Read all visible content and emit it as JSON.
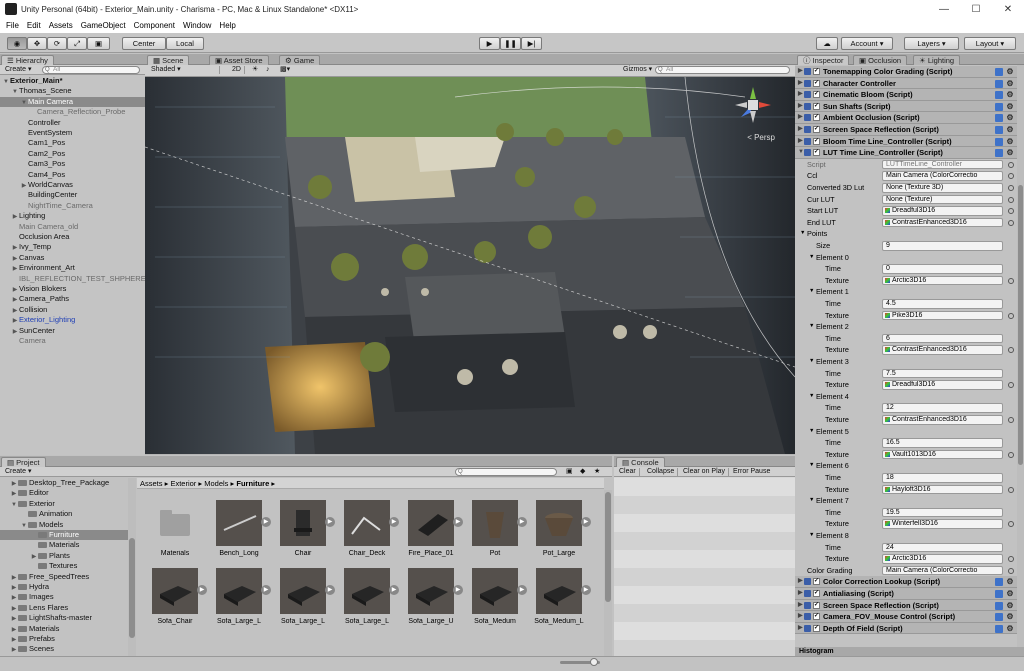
{
  "window": {
    "title": "Unity Personal (64bit) - Exterior_Main.unity - Charisma - PC, Mac & Linux Standalone* <DX11>"
  },
  "menu": [
    "File",
    "Edit",
    "Assets",
    "GameObject",
    "Component",
    "Window",
    "Help"
  ],
  "toolbar": {
    "pivot_label": "Center",
    "space_label": "Local",
    "account_label": "Account",
    "layers_label": "Layers",
    "layout_label": "Layout"
  },
  "hierarchy": {
    "tab": "Hierarchy",
    "create_label": "Create",
    "search_placeholder": "All",
    "items": [
      {
        "label": "Exterior_Main*",
        "bold": true,
        "depth": 0,
        "arrow": "open"
      },
      {
        "label": "Thomas_Scene",
        "depth": 1,
        "arrow": "open"
      },
      {
        "label": "Main Camera",
        "depth": 2,
        "arrow": "open",
        "selected": true
      },
      {
        "label": "Camera_Reflection_Probe",
        "depth": 3,
        "dim": true
      },
      {
        "label": "Controller",
        "depth": 2
      },
      {
        "label": "EventSystem",
        "depth": 2
      },
      {
        "label": "Cam1_Pos",
        "depth": 2
      },
      {
        "label": "Cam2_Pos",
        "depth": 2
      },
      {
        "label": "Cam3_Pos",
        "depth": 2
      },
      {
        "label": "Cam4_Pos",
        "depth": 2
      },
      {
        "label": "WorldCanvas",
        "depth": 2,
        "arrow": "closed"
      },
      {
        "label": "BuildingCenter",
        "depth": 2
      },
      {
        "label": "NightTime_Camera",
        "depth": 2,
        "dim": true
      },
      {
        "label": "Lighting",
        "depth": 1,
        "arrow": "closed"
      },
      {
        "label": "Main Camera_old",
        "depth": 1,
        "dim": true
      },
      {
        "label": "Occlusion Area",
        "depth": 1
      },
      {
        "label": "Ivy_Temp",
        "depth": 1,
        "arrow": "closed"
      },
      {
        "label": "Canvas",
        "depth": 1,
        "arrow": "closed"
      },
      {
        "label": "Environment_Art",
        "depth": 1,
        "arrow": "closed"
      },
      {
        "label": "IBL_REFLECTION_TEST_SHPHERE",
        "depth": 1,
        "dim": true
      },
      {
        "label": "Vision Blokers",
        "depth": 1,
        "arrow": "closed"
      },
      {
        "label": "Camera_Paths",
        "depth": 1,
        "arrow": "closed"
      },
      {
        "label": "Collision",
        "depth": 1,
        "arrow": "closed"
      },
      {
        "label": "Exterior_Lighting",
        "depth": 1,
        "arrow": "closed",
        "blue": true
      },
      {
        "label": "SunCenter",
        "depth": 1,
        "arrow": "closed"
      },
      {
        "label": "Camera",
        "depth": 1,
        "dim": true
      }
    ]
  },
  "scene": {
    "tabs": [
      "Scene",
      "Asset Store",
      "Game"
    ],
    "shading": "Shaded",
    "mode_2d": "2D",
    "gizmos": "Gizmos",
    "search_placeholder": "All",
    "persp_label": "< Persp"
  },
  "inspector": {
    "tabs": [
      "Inspector",
      "Occlusion",
      "Lighting"
    ],
    "components_top": [
      "Tonemapping Color Grading (Script)",
      "Character Controller",
      "Cinematic Bloom (Script)",
      "Sun Shafts (Script)",
      "Ambient Occlusion (Script)",
      "Screen Space Reflection (Script)",
      "Bloom Time Line_Controller (Script)",
      "LUT Time Line_Controller (Script)"
    ],
    "props": [
      {
        "label": "Script",
        "value": "LUTTimeLine_Controller",
        "indent": 0,
        "dim": true
      },
      {
        "label": "Ccl",
        "value": "Main Camera (ColorCorrectio",
        "indent": 0
      },
      {
        "label": "Converted 3D Lut",
        "value": "None (Texture 3D)",
        "indent": 0
      },
      {
        "label": "Cur LUT",
        "value": "None (Texture)",
        "indent": 0
      },
      {
        "label": "Start LUT",
        "value": "Dreadful3D16",
        "indent": 0,
        "lut": true
      },
      {
        "label": "End LUT",
        "value": "ContrastEnhanced3D16",
        "indent": 0,
        "lut": true
      },
      {
        "label": "Points",
        "value": null,
        "indent": 0,
        "arrow": true
      },
      {
        "label": "Size",
        "value": "9",
        "indent": 1
      },
      {
        "label": "Element 0",
        "value": null,
        "indent": 1,
        "arrow": true
      },
      {
        "label": "Time",
        "value": "0",
        "indent": 2
      },
      {
        "label": "Texture",
        "value": "Arctic3D16",
        "indent": 2,
        "lut": true
      },
      {
        "label": "Element 1",
        "value": null,
        "indent": 1,
        "arrow": true
      },
      {
        "label": "Time",
        "value": "4.5",
        "indent": 2
      },
      {
        "label": "Texture",
        "value": "Pike3D16",
        "indent": 2,
        "lut": true
      },
      {
        "label": "Element 2",
        "value": null,
        "indent": 1,
        "arrow": true
      },
      {
        "label": "Time",
        "value": "6",
        "indent": 2
      },
      {
        "label": "Texture",
        "value": "ContrastEnhanced3D16",
        "indent": 2,
        "lut": true
      },
      {
        "label": "Element 3",
        "value": null,
        "indent": 1,
        "arrow": true
      },
      {
        "label": "Time",
        "value": "7.5",
        "indent": 2
      },
      {
        "label": "Texture",
        "value": "Dreadful3D16",
        "indent": 2,
        "lut": true
      },
      {
        "label": "Element 4",
        "value": null,
        "indent": 1,
        "arrow": true
      },
      {
        "label": "Time",
        "value": "12",
        "indent": 2
      },
      {
        "label": "Texture",
        "value": "ContrastEnhanced3D16",
        "indent": 2,
        "lut": true
      },
      {
        "label": "Element 5",
        "value": null,
        "indent": 1,
        "arrow": true
      },
      {
        "label": "Time",
        "value": "16.5",
        "indent": 2
      },
      {
        "label": "Texture",
        "value": "Vault1013D16",
        "indent": 2,
        "lut": true
      },
      {
        "label": "Element 6",
        "value": null,
        "indent": 1,
        "arrow": true
      },
      {
        "label": "Time",
        "value": "18",
        "indent": 2
      },
      {
        "label": "Texture",
        "value": "Hayloft3D16",
        "indent": 2,
        "lut": true
      },
      {
        "label": "Element 7",
        "value": null,
        "indent": 1,
        "arrow": true
      },
      {
        "label": "Time",
        "value": "19.5",
        "indent": 2
      },
      {
        "label": "Texture",
        "value": "Winterfell3D16",
        "indent": 2,
        "lut": true
      },
      {
        "label": "Element 8",
        "value": null,
        "indent": 1,
        "arrow": true
      },
      {
        "label": "Time",
        "value": "24",
        "indent": 2
      },
      {
        "label": "Texture",
        "value": "Arctic3D16",
        "indent": 2,
        "lut": true
      },
      {
        "label": "Color Grading",
        "value": "Main Camera (ColorCorrectio",
        "indent": 0
      }
    ],
    "components_bottom": [
      "Color Correction Lookup (Script)",
      "Antialiasing (Script)",
      "Screen Space Reflection (Script)",
      "Camera_FOV_Mouse Control (Script)",
      "Depth Of Field (Script)"
    ],
    "histogram_label": "Histogram"
  },
  "project": {
    "tab": "Project",
    "create_label": "Create",
    "breadcrumb": [
      "Assets",
      "Exterior",
      "Models",
      "Furniture"
    ],
    "tree": [
      {
        "label": "Desktop_Tree_Package",
        "depth": 0,
        "arrow": "closed"
      },
      {
        "label": "Editor",
        "depth": 0,
        "arrow": "closed"
      },
      {
        "label": "Exterior",
        "depth": 0,
        "arrow": "open"
      },
      {
        "label": "Animation",
        "depth": 1
      },
      {
        "label": "Models",
        "depth": 1,
        "arrow": "open"
      },
      {
        "label": "Furniture",
        "depth": 2,
        "selected": true
      },
      {
        "label": "Materials",
        "depth": 2
      },
      {
        "label": "Plants",
        "depth": 2,
        "arrow": "closed"
      },
      {
        "label": "Textures",
        "depth": 2
      },
      {
        "label": "Free_SpeedTrees",
        "depth": 0,
        "arrow": "closed"
      },
      {
        "label": "Hydra",
        "depth": 0,
        "arrow": "closed"
      },
      {
        "label": "Images",
        "depth": 0,
        "arrow": "closed"
      },
      {
        "label": "Lens Flares",
        "depth": 0,
        "arrow": "closed"
      },
      {
        "label": "LightShafts-master",
        "depth": 0,
        "arrow": "closed"
      },
      {
        "label": "Materials",
        "depth": 0,
        "arrow": "closed"
      },
      {
        "label": "Prefabs",
        "depth": 0,
        "arrow": "closed"
      },
      {
        "label": "Scenes",
        "depth": 0,
        "arrow": "closed"
      }
    ],
    "assets": [
      {
        "label": "Materials",
        "kind": "folder"
      },
      {
        "label": "Bench_Long",
        "kind": "bench"
      },
      {
        "label": "Chair",
        "kind": "chair"
      },
      {
        "label": "Chair_Deck",
        "kind": "deck"
      },
      {
        "label": "Fire_Place_01",
        "kind": "fire"
      },
      {
        "label": "Pot",
        "kind": "pot"
      },
      {
        "label": "Pot_Large",
        "kind": "potl"
      },
      {
        "label": "Sofa_Chair",
        "kind": "sofa"
      },
      {
        "label": "Sofa_Large_L",
        "kind": "sofa"
      },
      {
        "label": "Sofa_Large_L",
        "kind": "sofa"
      },
      {
        "label": "Sofa_Large_L",
        "kind": "sofa"
      },
      {
        "label": "Sofa_Large_U",
        "kind": "sofa"
      },
      {
        "label": "Sofa_Medum",
        "kind": "sofa"
      },
      {
        "label": "Sofa_Medum_L",
        "kind": "sofa"
      }
    ]
  },
  "console": {
    "tab": "Console",
    "buttons": [
      "Clear",
      "Collapse",
      "Clear on Play",
      "Error Pause"
    ]
  }
}
